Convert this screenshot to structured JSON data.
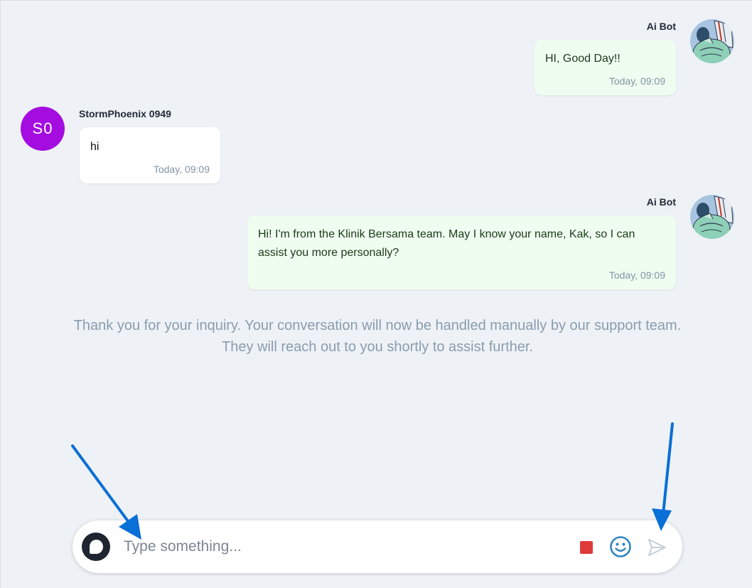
{
  "messages": [
    {
      "sender": "Ai Bot",
      "text": "HI, Good Day!!",
      "time": "Today, 09:09"
    },
    {
      "sender": "StormPhoenix 0949",
      "avatar_initials": "S0",
      "avatar_color": "#a40ce0",
      "text": "hi",
      "time": "Today, 09:09"
    },
    {
      "sender": "Ai Bot",
      "text": "Hi! I'm from the Klinik Bersama team. May I know your name, Kak, so I can assist you more personally?",
      "time": "Today, 09:09"
    }
  ],
  "notice": {
    "line1": "Thank you for your inquiry. Your conversation will now be handled manually by our support team.",
    "line2": "They will reach out to you shortly to assist further."
  },
  "composer": {
    "placeholder": "Type something...",
    "attach_icon": "chat-bubble-icon",
    "stop_icon": "stop-square-icon",
    "stop_color": "#df3a3a",
    "emoji_icon": "smiley-icon",
    "emoji_color": "#2e86c1",
    "send_icon": "send-icon"
  },
  "colors": {
    "background": "#eef2f6",
    "bot_bubble": "#effdf1",
    "user_bubble": "#ffffff",
    "annotation_arrow": "#0a6fd6"
  }
}
